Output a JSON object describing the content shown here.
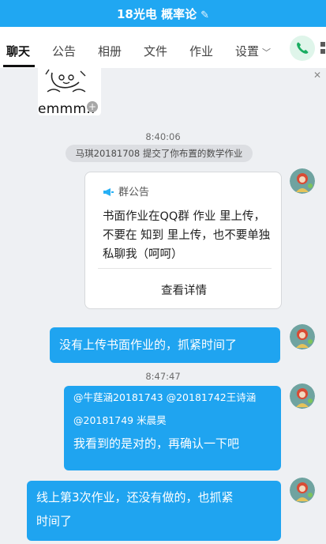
{
  "header": {
    "title": "18光电 概率论",
    "edit_icon": "pencil-edit-icon"
  },
  "tabs": [
    {
      "label": "聊天"
    },
    {
      "label": "公告"
    },
    {
      "label": "相册"
    },
    {
      "label": "文件"
    },
    {
      "label": "作业"
    },
    {
      "label": "设置"
    }
  ],
  "toolbar": {
    "call_icon": "phone-icon",
    "apps_icon": "grid-icon"
  },
  "messages": {
    "sticker_text": "emmm..",
    "time1": "8:40:06",
    "system_notice": "马琪20181708 提交了你布置的数学作业",
    "announcement": {
      "header": "群公告",
      "body": "书面作业在QQ群  作业  里上传，不要在 知到 里上传，也不要单独私聊我（呵呵）",
      "link": "查看详情"
    },
    "msg1": "没有上传书面作业的，抓紧时间了",
    "time2": "8:47:47",
    "msg2": {
      "mention1": "@牛莛涵20181743 @20181742王诗涵",
      "mention2": "@20181749 米晨昊",
      "text": "我看到的是对的，再确认一下吧"
    },
    "msg3": {
      "line1": "线上第3次作业，还没有做的，也抓紧",
      "line2": "时间了"
    }
  },
  "colors": {
    "accent": "#20a7f2",
    "bubble": "#1fa4f0",
    "background": "#eef0f3"
  }
}
